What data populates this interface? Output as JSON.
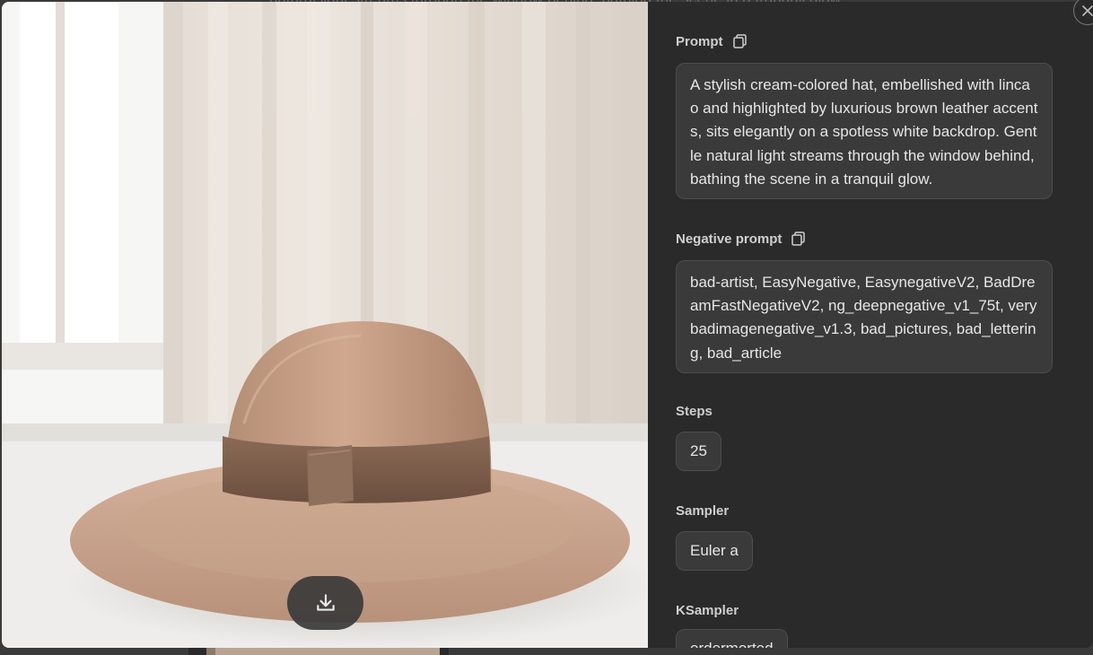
{
  "background": {
    "caption_text": "natural light streams through the window behind, bathing the scene in a tranquil glow."
  },
  "image": {
    "alt": "Straw hat with brown leather band by a window",
    "colors": {
      "straw": "#c8a48c",
      "band": "#7a5c4a",
      "wall": "#e4ddd5"
    }
  },
  "actions": {
    "download_icon": "download-icon",
    "close_icon": "close-icon",
    "copy_icon": "copy-icon"
  },
  "details": {
    "prompt_label": "Prompt",
    "prompt_text": "A stylish cream-colored hat, embellished with lincao and highlighted by luxurious brown leather accents, sits elegantly on a spotless white backdrop. Gentle natural light streams through the window behind, bathing the scene in a tranquil glow.",
    "negative_label": "Negative prompt",
    "negative_text": "bad-artist, EasyNegative, EasynegativeV2, BadDreamFastNegativeV2, ng_deepnegative_v1_75t, verybadimagenegative_v1.3, bad_pictures, bad_lettering, bad_article",
    "steps_label": "Steps",
    "steps_value": "25",
    "sampler_label": "Sampler",
    "sampler_value": "Euler a",
    "ksampler_label": "KSampler",
    "ksampler_value": "ordermorted"
  }
}
